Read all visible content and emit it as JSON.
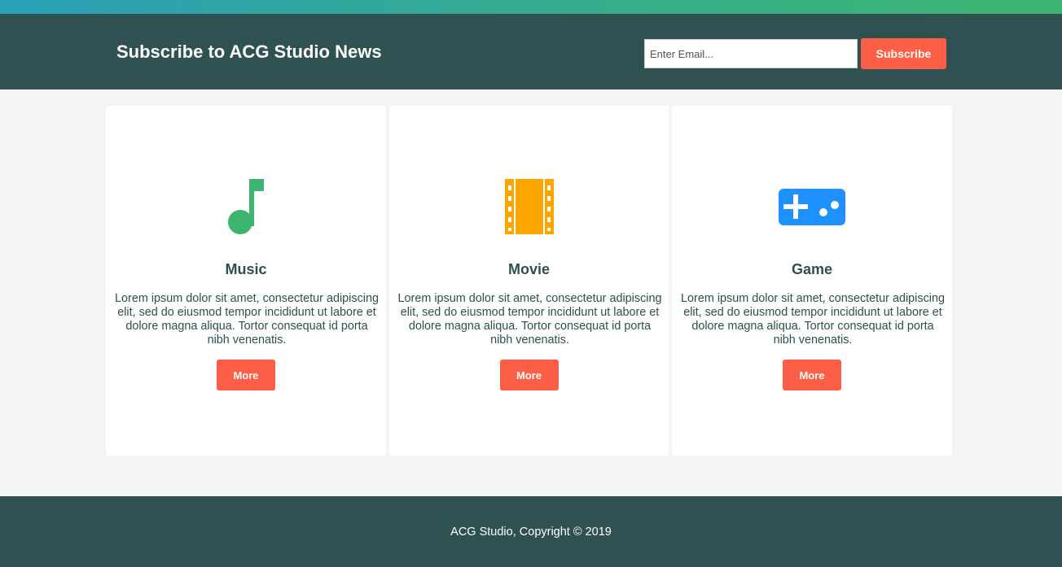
{
  "colors": {
    "header_bg": "#2f5151",
    "page_bg": "#f4f4f4",
    "accent_button": "#fd5f46",
    "text_dark": "#2f4f4f",
    "music_icon": "#3db571",
    "movie_icon": "#ffa500",
    "game_icon": "#1e90ff"
  },
  "subscribe": {
    "title": "Subscribe to ACG Studio News",
    "email_placeholder": "Enter Email...",
    "email_value": "",
    "button_label": "Subscribe"
  },
  "cards": [
    {
      "icon": "music-note-icon",
      "title": "Music",
      "text": "Lorem ipsum dolor sit amet, consectetur adipiscing elit, sed do eiusmod tempor incididunt ut labore et dolore magna aliqua. Tortor consequat id porta nibh venenatis.",
      "button_label": "More"
    },
    {
      "icon": "film-strip-icon",
      "title": "Movie",
      "text": "Lorem ipsum dolor sit amet, consectetur adipiscing elit, sed do eiusmod tempor incididunt ut labore et dolore magna aliqua. Tortor consequat id porta nibh venenatis.",
      "button_label": "More"
    },
    {
      "icon": "gamepad-icon",
      "title": "Game",
      "text": "Lorem ipsum dolor sit amet, consectetur adipiscing elit, sed do eiusmod tempor incididunt ut labore et dolore magna aliqua. Tortor consequat id porta nibh venenatis.",
      "button_label": "More"
    }
  ],
  "footer": {
    "text": "ACG Studio, Copyright © 2019"
  }
}
